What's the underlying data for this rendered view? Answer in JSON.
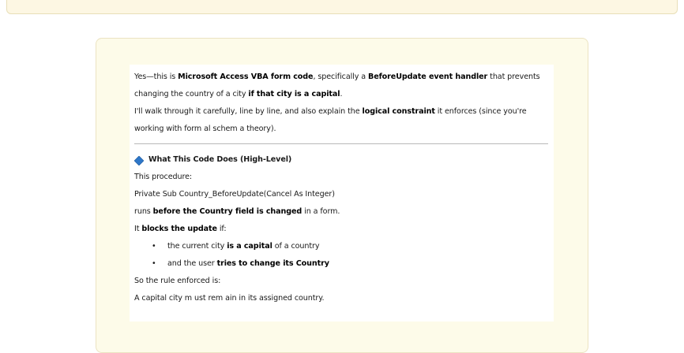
{
  "intro": {
    "p1_a": "Yes—this is ",
    "p1_b": "Microsoft Access VBA form code",
    "p1_c": ", specifically a ",
    "p1_d": "BeforeUpdate event handler",
    "p1_e": " that prevents",
    "p2_a": "changing the country  of a city ",
    "p2_b": "if that city is a capital",
    "p2_c": ".",
    "p3_a": "I'll walk through  it carefully, line by line, and also explain the ",
    "p3_b": "logical constraint",
    "p3_c": " it enforces (since you're",
    "p4": "working with form al schem a theory)."
  },
  "section": {
    "icon": "blue-diamond-icon",
    "title": "What This Code Does (High-Level)",
    "l1": "This procedure:",
    "l2": "Private Sub Country_BeforeUpdate(Cancel As Integer)",
    "l3_a": "runs ",
    "l3_b": "before the Country field is changed",
    "l3_c": " in a form.",
    "l4_a": "It ",
    "l4_b": "blocks the update",
    "l4_c": " if:",
    "bullets": [
      {
        "a": "the current city ",
        "b": "is a capital",
        "c": " of a country"
      },
      {
        "a": "and the user ",
        "b": "tries to change its Country",
        "c": ""
      }
    ],
    "bullet_glyph": "•",
    "l5": "So the rule enforced is:",
    "l6": "A capital city m ust rem ain in its assigned country."
  },
  "colors": {
    "card_bg": "#fdfbe9",
    "diamond": "#2e77c8"
  }
}
